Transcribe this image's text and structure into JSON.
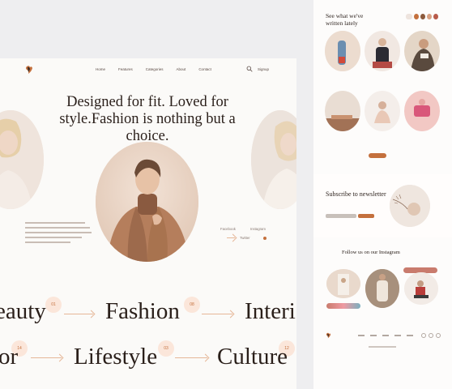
{
  "nav": {
    "links": [
      "Home",
      "Features",
      "Categories",
      "About",
      "Contact"
    ],
    "signup": "Signup",
    "search_icon": "search-icon"
  },
  "hero": {
    "title": "Designed for fit. Loved for style.Fashion is nothing but a choice."
  },
  "social": {
    "facebook": "Facebook",
    "instagram": "Instagram",
    "twitter": "Twitter"
  },
  "categories": {
    "row1": [
      {
        "label": "eauty",
        "num": "01"
      },
      {
        "label": "Fashion",
        "num": "08"
      },
      {
        "label": "Interi",
        "num": ""
      }
    ],
    "row2": [
      {
        "label": "or",
        "num": "14"
      },
      {
        "label": "Lifestyle",
        "num": "03"
      },
      {
        "label": "Culture",
        "num": "12"
      }
    ]
  },
  "blog": {
    "title": "See what we've written lately"
  },
  "subscribe": {
    "title": "Subscribe to newsletter"
  },
  "instagram": {
    "title": "Follow us on our Instagram"
  },
  "colors": {
    "accent": "#c4703d",
    "peach": "#fbe6da",
    "text": "#2a1f1a"
  }
}
